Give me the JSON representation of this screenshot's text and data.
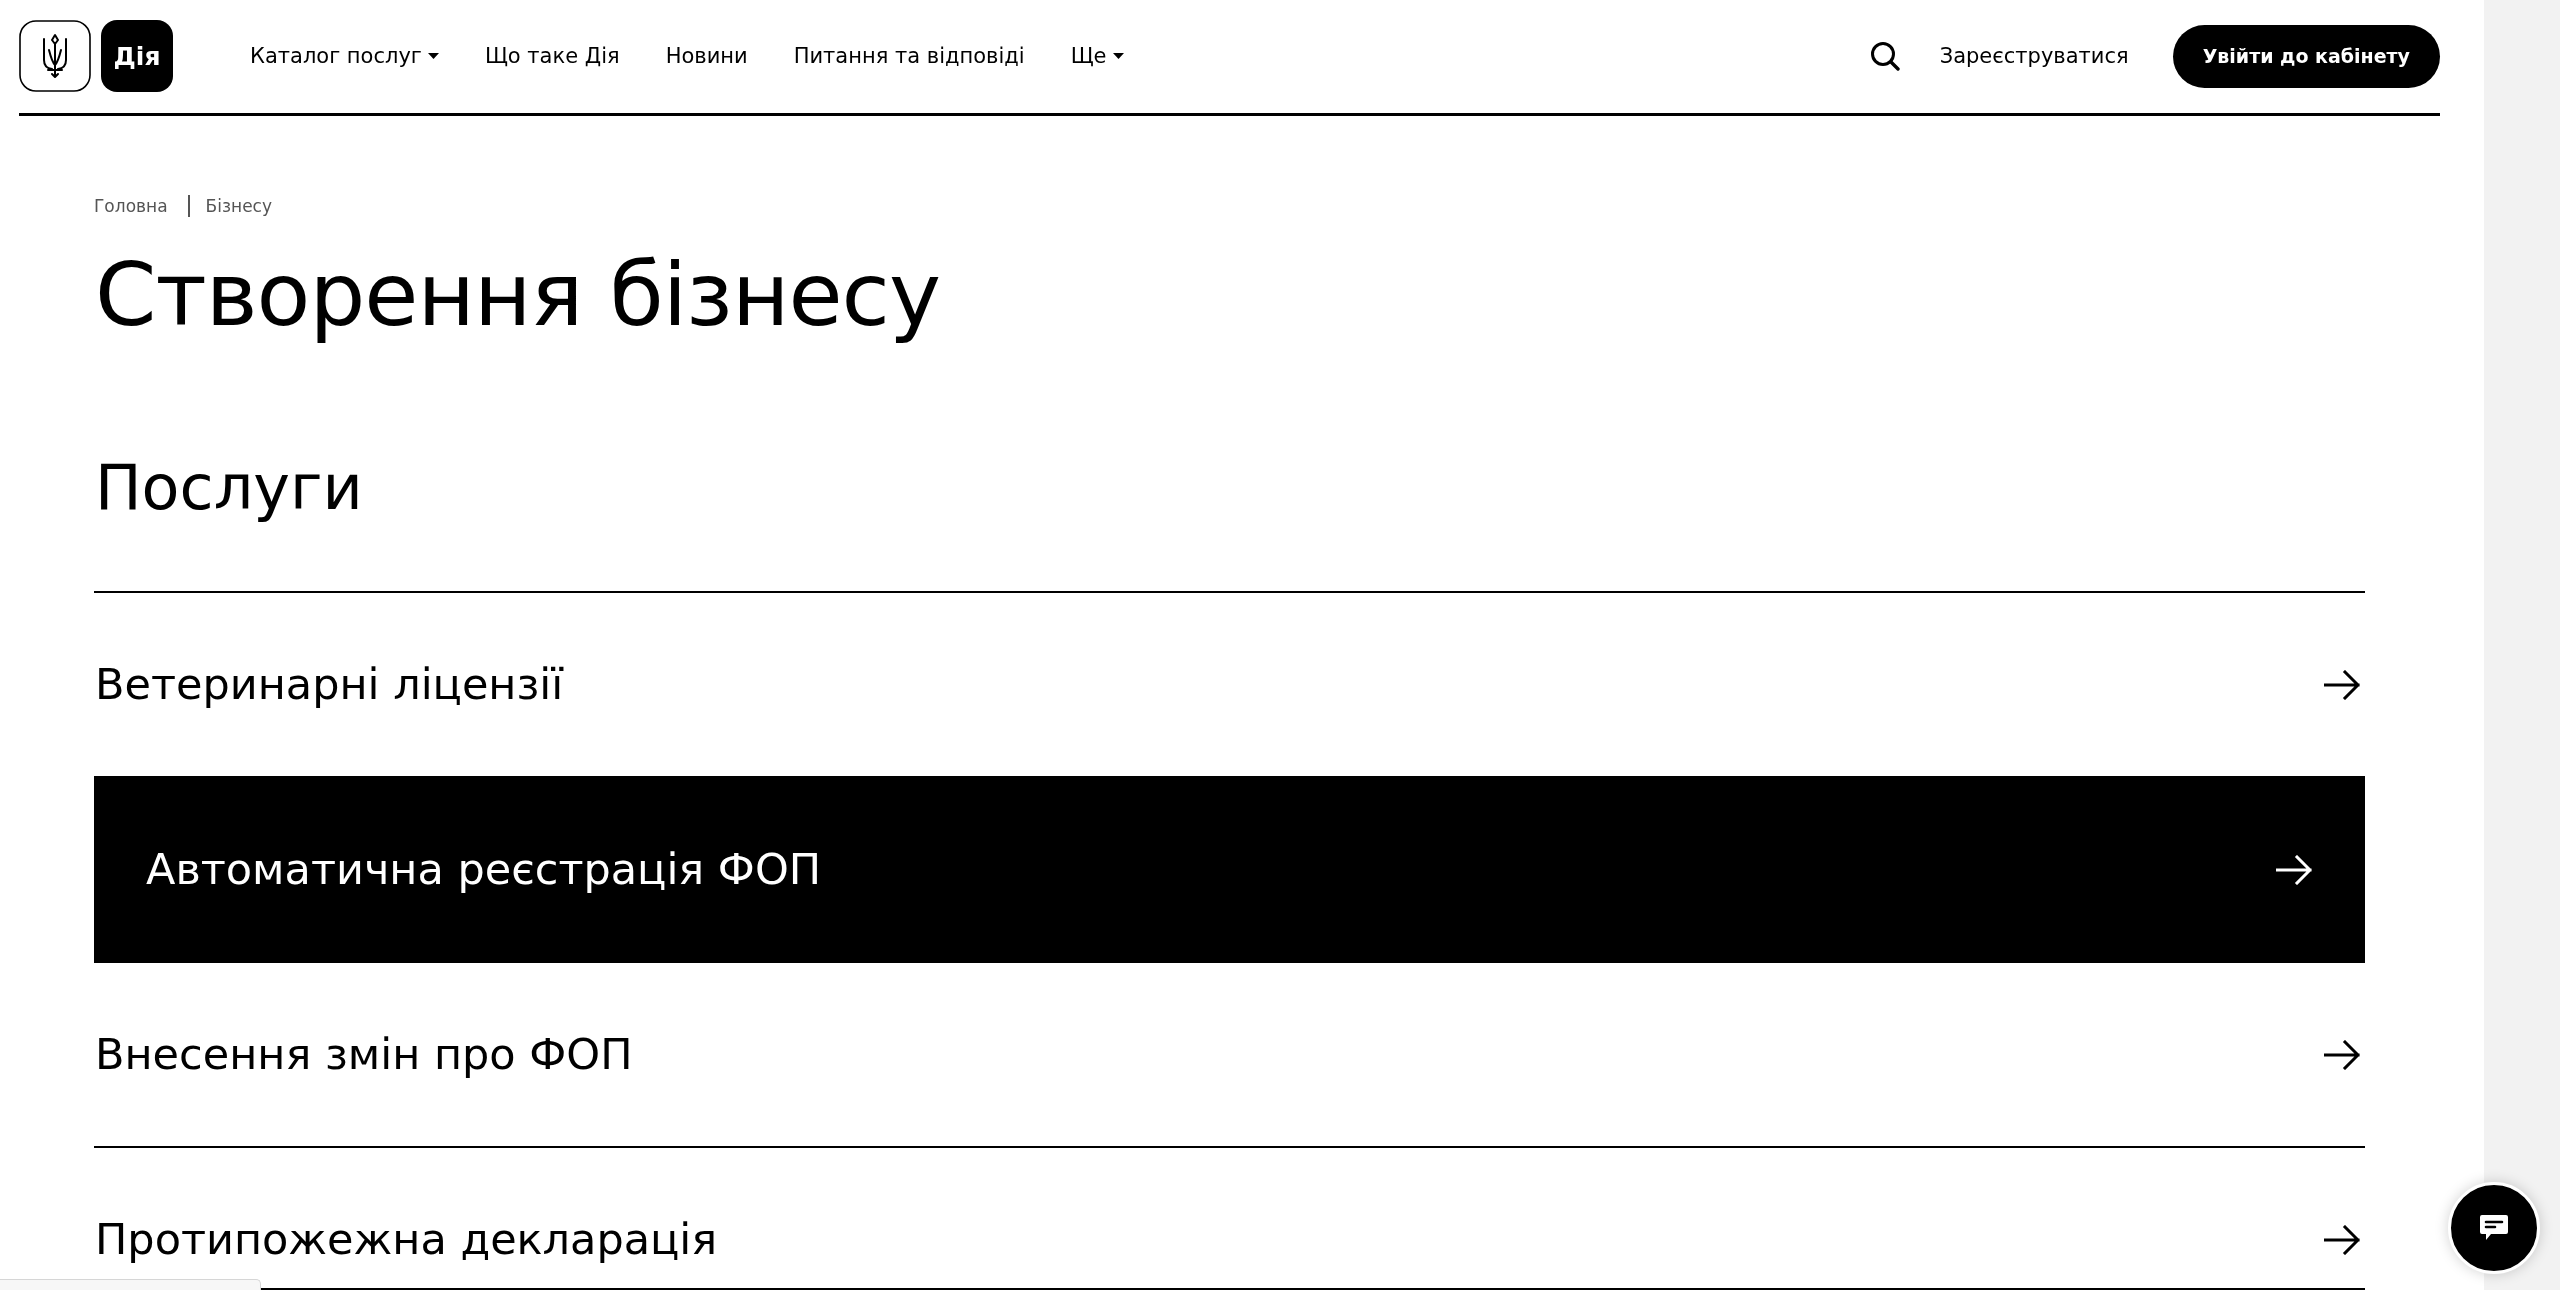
{
  "header": {
    "logo_text": "Дія",
    "nav": [
      {
        "label": "Каталог послуг",
        "has_dropdown": true
      },
      {
        "label": "Що таке Дія",
        "has_dropdown": false
      },
      {
        "label": "Новини",
        "has_dropdown": false
      },
      {
        "label": "Питання та відповіді",
        "has_dropdown": false
      },
      {
        "label": "Ще",
        "has_dropdown": true
      }
    ],
    "register_link": "Зареєструватися",
    "login_button": "Увійти до кабінету"
  },
  "breadcrumbs": [
    {
      "label": "Головна"
    },
    {
      "label": "Бізнесу"
    }
  ],
  "page_title": "Створення бізнесу",
  "section_title": "Послуги",
  "services": [
    {
      "label": "Ветеринарні ліцензії",
      "selected": false
    },
    {
      "label": "Автоматична реєстрація ФОП",
      "selected": true
    },
    {
      "label": "Внесення змін про ФОП",
      "selected": false
    },
    {
      "label": "Протипожежна декларація",
      "selected": false
    }
  ]
}
